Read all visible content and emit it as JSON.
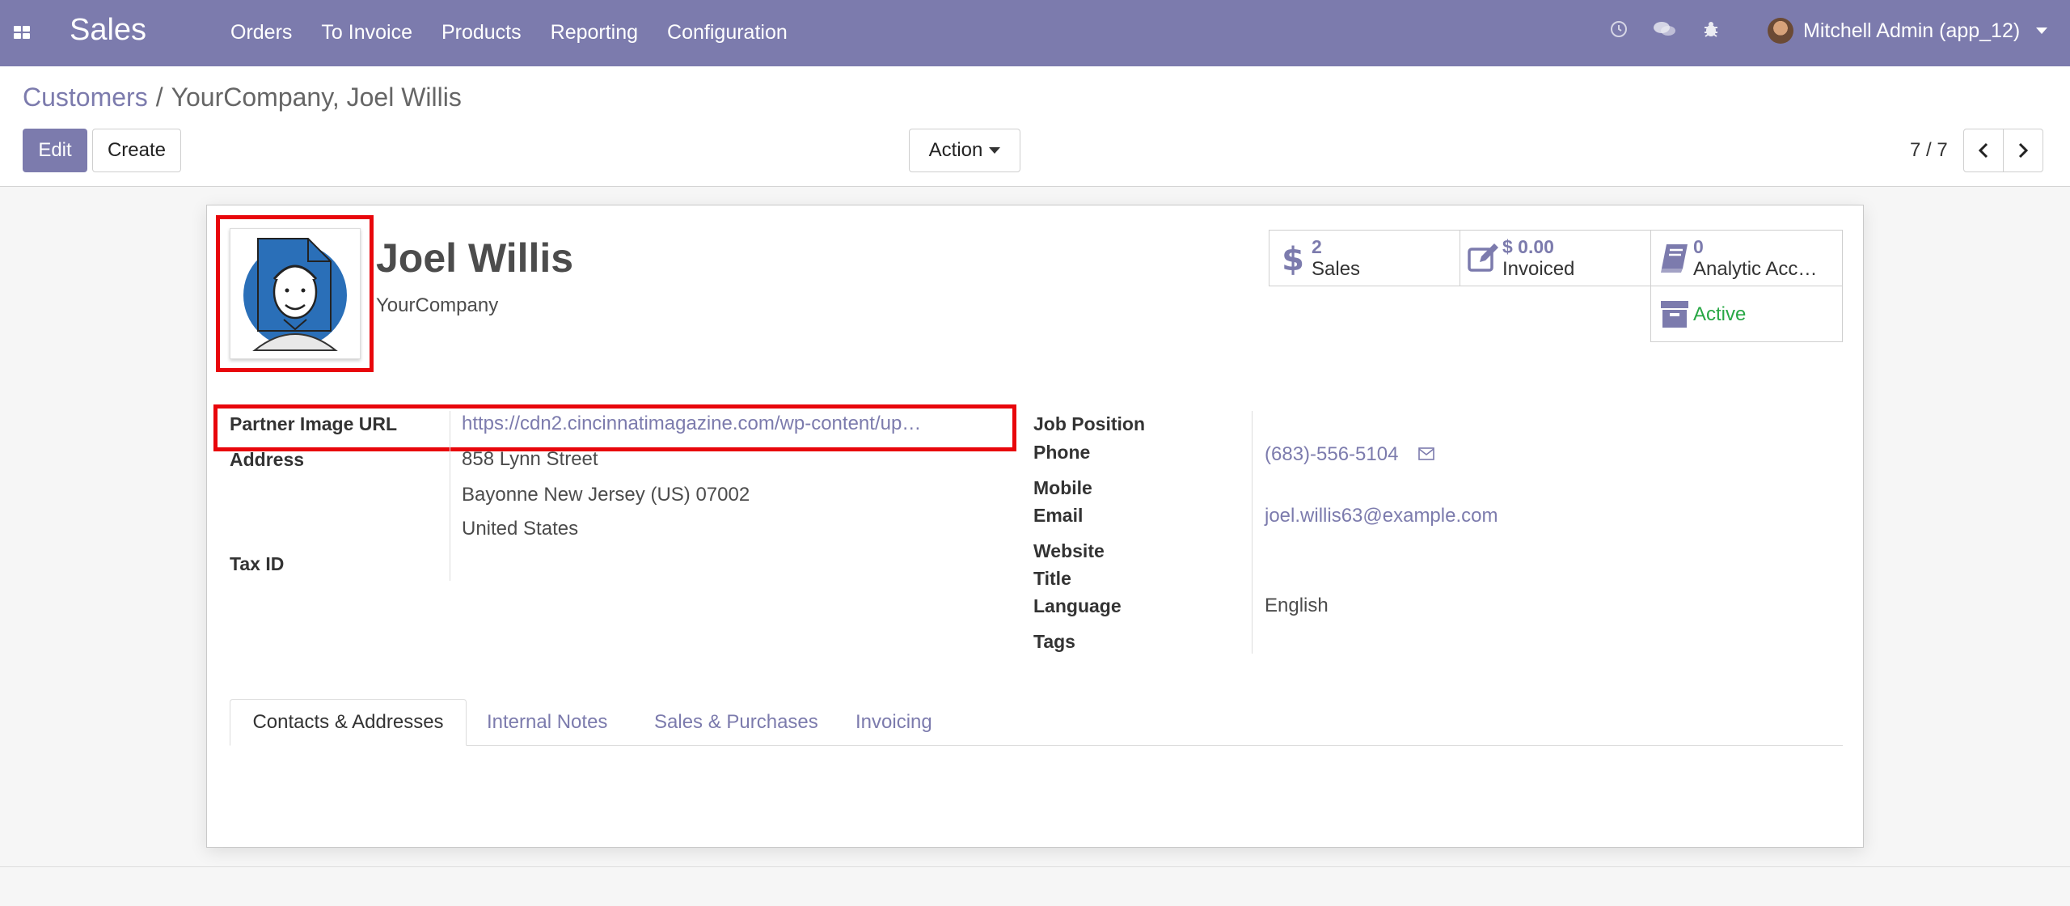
{
  "navbar": {
    "app_name": "Sales",
    "menu": [
      "Orders",
      "To Invoice",
      "Products",
      "Reporting",
      "Configuration"
    ],
    "user": "Mitchell Admin (app_12)",
    "icons": [
      "clock-icon",
      "chat-icon",
      "bug-icon"
    ],
    "color": "#7c7bad"
  },
  "breadcrumb": {
    "parent": "Customers",
    "separator": "/",
    "current": "YourCompany, Joel Willis"
  },
  "buttons": {
    "edit": "Edit",
    "create": "Create",
    "action": "Action"
  },
  "pager": {
    "value": "7 / 7"
  },
  "partner": {
    "name": "Joel Willis",
    "company": "YourCompany"
  },
  "smart_buttons": [
    {
      "icon": "dollar-icon",
      "value": "2",
      "label": "Sales"
    },
    {
      "icon": "pencil-square-icon",
      "value": "$ 0.00",
      "label": "Invoiced"
    },
    {
      "icon": "book-icon",
      "value": "0",
      "label": "Analytic Acc…"
    },
    {
      "icon": "archive-icon",
      "label": "Active"
    }
  ],
  "left_fields": {
    "image_url_label": "Partner Image URL",
    "image_url_value": "https://cdn2.cincinnatimagazine.com/wp-content/up…",
    "address_label": "Address",
    "street": "858 Lynn Street",
    "city_line": "Bayonne  New Jersey (US)  07002",
    "country": "United States",
    "tax_label": "Tax ID"
  },
  "right_fields": {
    "job_label": "Job Position",
    "phone_label": "Phone",
    "phone_value": "(683)-556-5104",
    "mobile_label": "Mobile",
    "email_label": "Email",
    "email_value": "joel.willis63@example.com",
    "website_label": "Website",
    "title_label": "Title",
    "language_label": "Language",
    "language_value": "English",
    "tags_label": "Tags"
  },
  "tabs": [
    "Contacts & Addresses",
    "Internal Notes",
    "Sales & Purchases",
    "Invoicing"
  ],
  "colors": {
    "accent": "#7c7bad",
    "highlight": "#e8060b",
    "active": "#28a745"
  }
}
